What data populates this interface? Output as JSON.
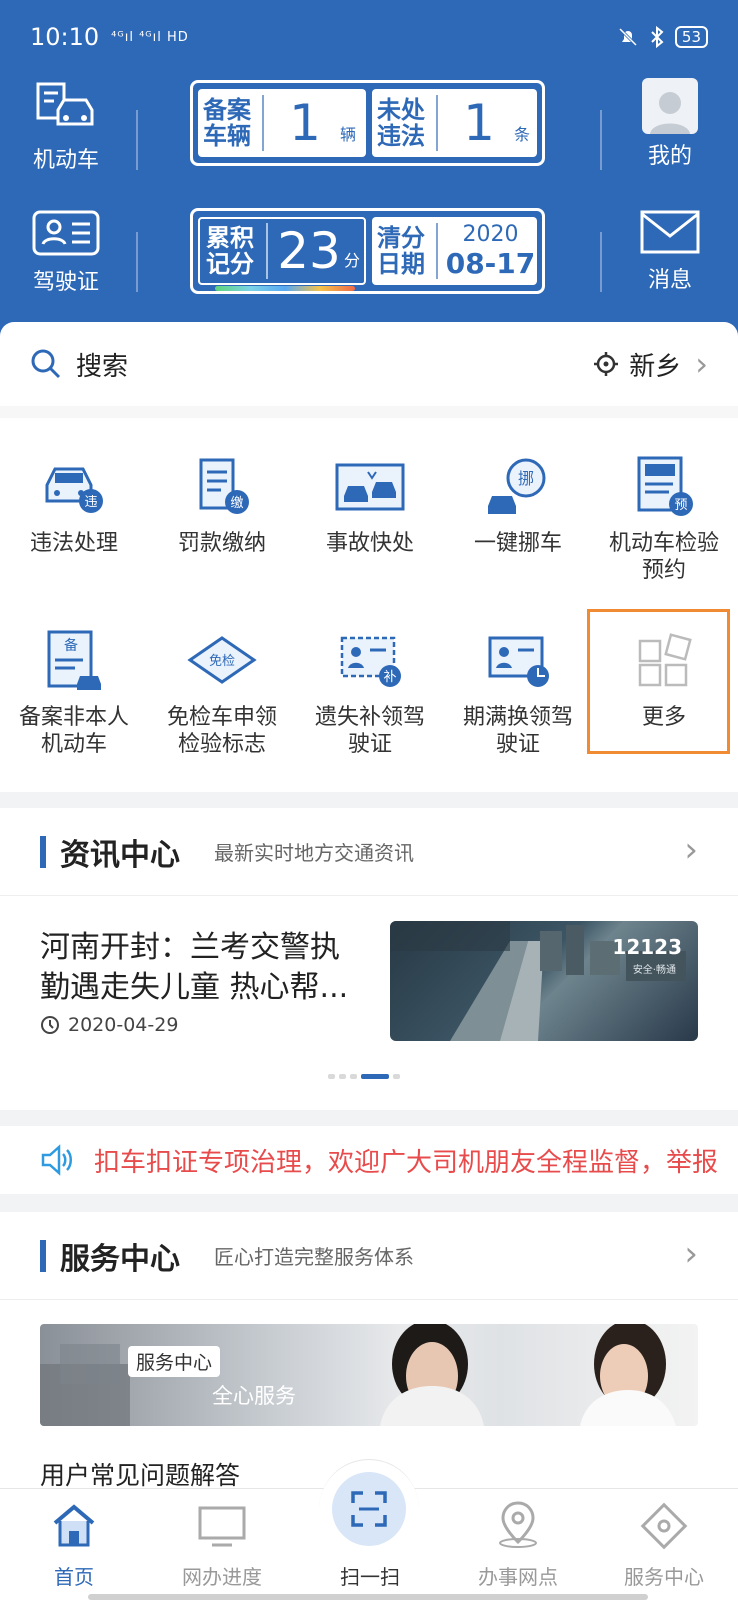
{
  "status_bar": {
    "time": "10:10",
    "network": "⁴ᴳıl ⁴ᴳıl HD",
    "battery": "53"
  },
  "header": {
    "motor_vehicle_label": "机动车",
    "license_label": "驾驶证",
    "mine_label": "我的",
    "message_label": "消息",
    "card1": {
      "left_label_1": "备案",
      "left_label_2": "车辆",
      "left_value": "1",
      "left_unit": "辆",
      "right_label_1": "未处",
      "right_label_2": "违法",
      "right_value": "1",
      "right_unit": "条"
    },
    "card2": {
      "left_label_1": "累积",
      "left_label_2": "记分",
      "left_value": "23",
      "left_unit": "分",
      "right_label_1": "清分",
      "right_label_2": "日期",
      "right_year": "2020",
      "right_date": "08-17"
    }
  },
  "search": {
    "label": "搜索",
    "location": "新乡"
  },
  "services": [
    {
      "label": "违法处理",
      "icon": "violation-car-icon",
      "badge": "违"
    },
    {
      "label": "罚款缴纳",
      "icon": "fine-payment-icon",
      "badge": "缴"
    },
    {
      "label": "事故快处",
      "icon": "accident-icon",
      "badge": ""
    },
    {
      "label": "一键挪车",
      "icon": "move-car-icon",
      "badge": "挪"
    },
    {
      "label": "机动车检验预约",
      "icon": "inspection-booking-icon",
      "badge": "预"
    },
    {
      "label": "备案非本人机动车",
      "icon": "register-vehicle-icon",
      "badge": "备"
    },
    {
      "label": "免检车申领检验标志",
      "icon": "exempt-inspection-icon",
      "badge": "免检"
    },
    {
      "label": "遗失补领驾驶证",
      "icon": "reissue-license-icon",
      "badge": "补"
    },
    {
      "label": "期满换领驾驶证",
      "icon": "renew-license-icon",
      "badge": ""
    },
    {
      "label": "更多",
      "icon": "more-grid-icon",
      "badge": ""
    }
  ],
  "news": {
    "title": "资讯中心",
    "subtitle": "最新实时地方交通资讯",
    "headline": "河南开封：兰考交警执勤遇走失儿童 热心帮...",
    "date": "2020-04-29",
    "image_text": "12123",
    "image_subtext": "安全·畅通"
  },
  "notice": {
    "text": "扣车扣证专项治理，欢迎广大司机朋友全程监督，举报"
  },
  "service_center": {
    "title": "服务中心",
    "subtitle": "匠心打造完整服务体系",
    "banner_tag": "服务中心",
    "banner_text": "全心服务",
    "faq": "用户常见问题解答"
  },
  "tabbar": [
    {
      "label": "首页",
      "icon": "home-icon"
    },
    {
      "label": "网办进度",
      "icon": "monitor-icon"
    },
    {
      "label": "扫一扫",
      "icon": "scan-icon"
    },
    {
      "label": "办事网点",
      "icon": "location-pin-icon"
    },
    {
      "label": "服务中心",
      "icon": "service-icon"
    }
  ],
  "colors": {
    "primary": "#2e69b7",
    "highlight": "#f08a33",
    "notice": "#e84b4b"
  }
}
